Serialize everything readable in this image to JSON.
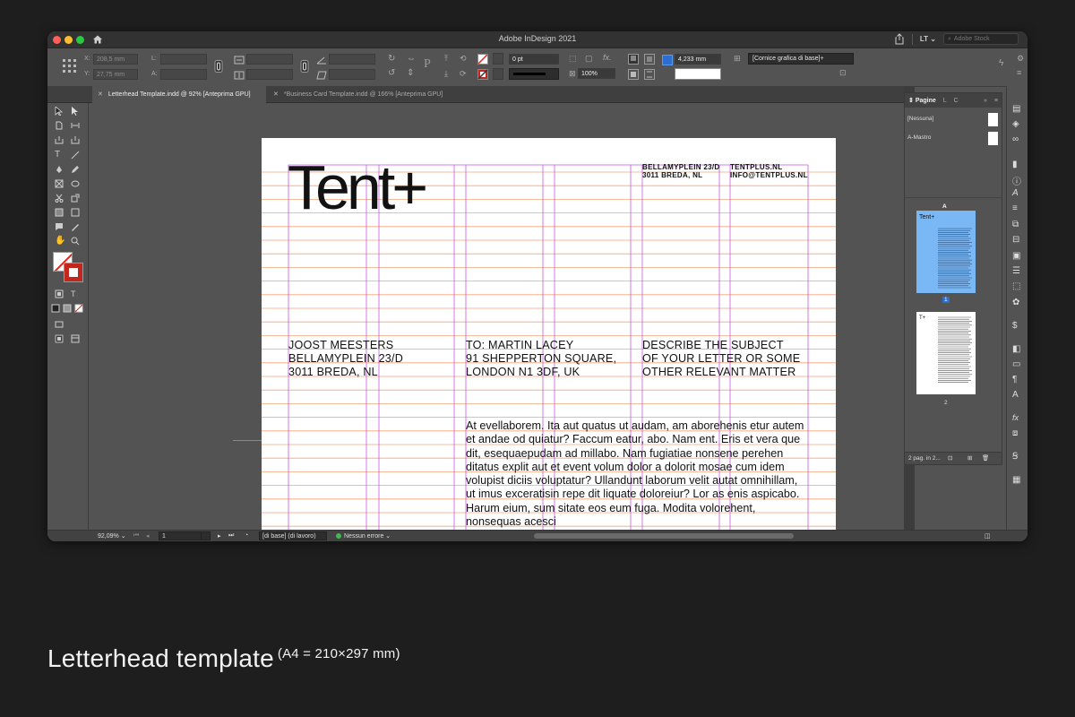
{
  "window": {
    "title": "Adobe InDesign 2021",
    "workspace": "LT",
    "stock_placeholder": "Adobe Stock"
  },
  "controlbar": {
    "x_label": "X:",
    "x_value": "208,5 mm",
    "y_label": "Y:",
    "y_value": "27,75 mm",
    "l_label": "L:",
    "a_label": "A:",
    "stroke_weight": "0 pt",
    "zoom_percent": "100%",
    "measure_value": "4,233 mm",
    "frame_style": "[Cornice grafica di base]+"
  },
  "tabs": [
    {
      "label": "Letterhead Template.indd @ 92% [Anteprima GPU]"
    },
    {
      "label": "*Business Card Template.indd @ 166% [Anteprima GPU]"
    }
  ],
  "document": {
    "logo": "Tent+",
    "header_col1": [
      "BELLAMYPLEIN 23/D",
      "3011  BREDA, NL"
    ],
    "header_col2": [
      "TENTPLUS.NL",
      "INFO@TENTPLUS.NL"
    ],
    "sender": [
      "JOOST MEESTERS",
      "BELLAMYPLEIN 23/D",
      "3011  BREDA, NL"
    ],
    "recipient": [
      "TO: MARTIN LACEY",
      "91 SHEPPERTON SQUARE,",
      "LONDON N1 3DF, UK"
    ],
    "subject": [
      "DESCRIBE THE SUBJECT",
      "OF YOUR LETTER OR SOME",
      "OTHER RELEVANT MATTER"
    ],
    "body": "At evellaborem. Ita aut quatus ut audam, am aborehenis etur autem et andae od quiatur? Faccum eatur, abo. Nam ent. Eris et vera que dit, esequaepudam ad millabo. Nam fugiatiae nonsene perehen ditatus explit aut et event volum dolor a dolorit mosae cum idem volupist diciis voluptatur? Ullandunt laborum velit autat omnihillam, ut imus exceratisin repe dit liquate doloreiur? Lor as enis aspicabo. Harum eium, sum sitate eos eum fuga. Modita volorehent, nonsequas acesci"
  },
  "pages_panel": {
    "tab_pages": "Pagine",
    "tab_l": "L",
    "tab_c": "C",
    "master_none": "[Nessuna]",
    "master_a": "A-Mastro",
    "page1_badge": "A",
    "page1_number": "1",
    "page2_number": "2",
    "footer": "2 pag. in 2..."
  },
  "statusbar": {
    "zoom": "92,09%",
    "page": "1",
    "profile": "[di base] (di lavoro)",
    "errors": "Nessun errore"
  },
  "caption": {
    "title": "Letterhead template",
    "note": "(A4 = 210×297 mm)"
  },
  "colors": {
    "baseline_grid": "#f2a57a",
    "column_guides": "#c35ae0",
    "thumb_blue": "#7ab8f5"
  }
}
